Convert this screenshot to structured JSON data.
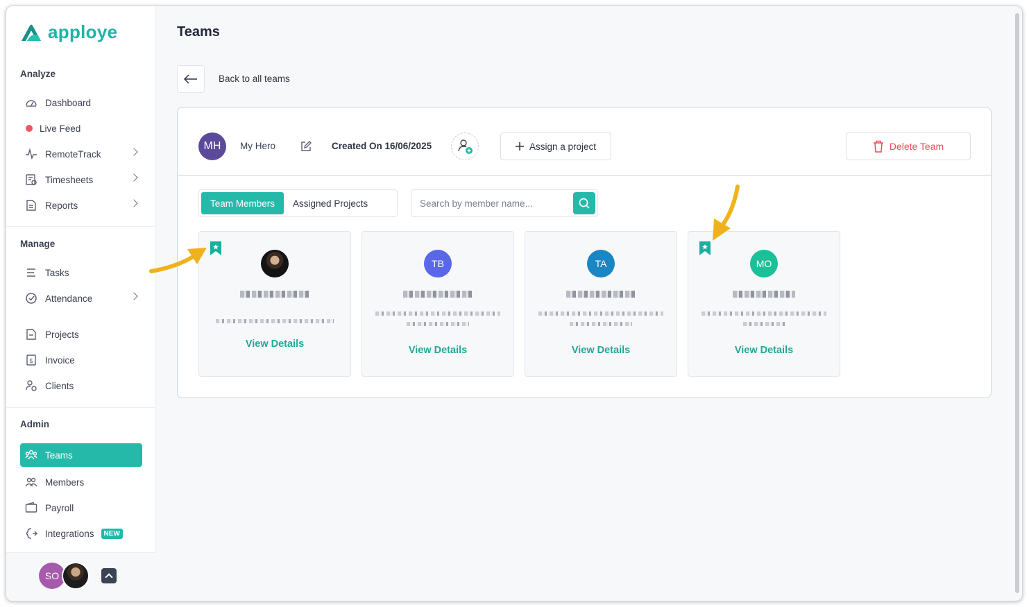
{
  "app": {
    "logo_text": "apploye",
    "page_title": "Teams"
  },
  "colors": {
    "accent": "#25b9a9",
    "danger": "#ef4b5c",
    "team_avatar": "#5b4a9c"
  },
  "sidebar": {
    "sections": {
      "analyze": "Analyze",
      "manage": "Manage",
      "admin": "Admin"
    },
    "items": {
      "dashboard": "Dashboard",
      "live_feed": "Live Feed",
      "remotetrack": "RemoteTrack",
      "timesheets": "Timesheets",
      "reports": "Reports",
      "tasks": "Tasks",
      "attendance": "Attendance",
      "projects": "Projects",
      "invoice": "Invoice",
      "clients": "Clients",
      "teams": "Teams",
      "members": "Members",
      "payroll": "Payroll",
      "integrations": "Integrations"
    },
    "new_badge": "NEW",
    "footer": {
      "user_initials": "SO"
    }
  },
  "main": {
    "back_label": "Back to all teams",
    "team": {
      "initials": "MH",
      "name": "My Hero",
      "created": "Created On 16/06/2025"
    },
    "assign_label": "Assign a project",
    "delete_label": "Delete Team",
    "tabs": [
      {
        "label": "Team Members",
        "active": true
      },
      {
        "label": "Assigned Projects",
        "active": false
      }
    ],
    "search": {
      "placeholder": "Search by member name...",
      "value": ""
    },
    "members": [
      {
        "initials": "",
        "avatar": "photo",
        "bookmarked": true,
        "view_label": "View Details"
      },
      {
        "initials": "TB",
        "avatar_color": "#5a67e8",
        "bookmarked": false,
        "view_label": "View Details"
      },
      {
        "initials": "TA",
        "avatar_color": "#1a86c4",
        "bookmarked": false,
        "view_label": "View Details"
      },
      {
        "initials": "MO",
        "avatar_color": "#1cbf97",
        "bookmarked": true,
        "view_label": "View Details"
      }
    ]
  }
}
